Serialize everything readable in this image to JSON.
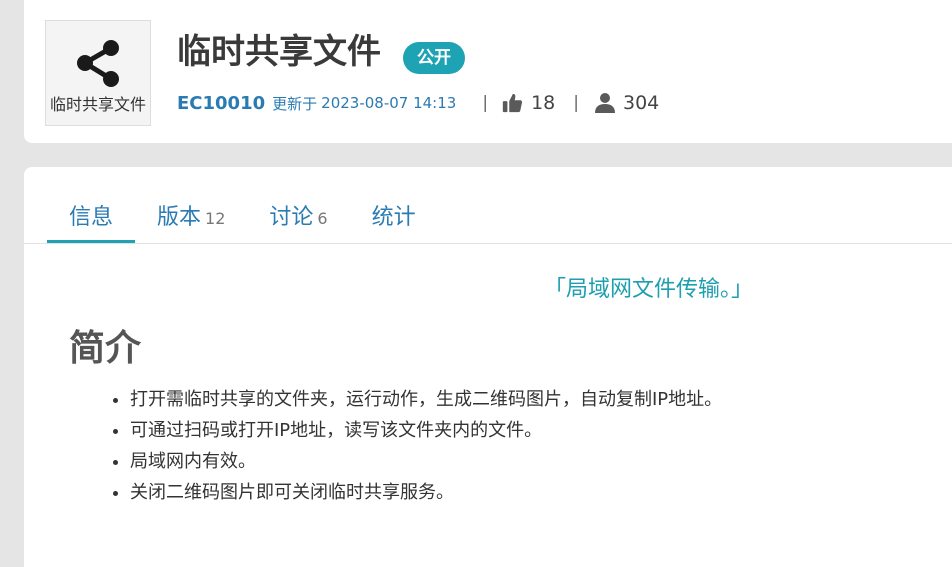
{
  "app": {
    "icon": "share-icon",
    "icon_caption": "临时共享文件",
    "title": "临时共享文件",
    "badge": "公开",
    "author_id": "EC10010",
    "updated_label": "更新于",
    "updated_time": "2023-08-07 14:13",
    "likes": "18",
    "users": "304",
    "colors": {
      "accent": "#1ea3b4",
      "link": "#2b7bb3"
    }
  },
  "tabs": [
    {
      "label": "信息",
      "count": "",
      "active": true
    },
    {
      "label": "版本",
      "count": "12",
      "active": false
    },
    {
      "label": "讨论",
      "count": "6",
      "active": false
    },
    {
      "label": "统计",
      "count": "",
      "active": false
    }
  ],
  "content": {
    "tagline": "「局域网文件传输。」",
    "heading": "简介",
    "features": [
      "打开需临时共享的文件夹，运行动作，生成二维码图片，自动复制IP地址。",
      "可通过扫码或打开IP地址，读写该文件夹内的文件。",
      "局域网内有效。",
      "关闭二维码图片即可关闭临时共享服务。"
    ]
  }
}
